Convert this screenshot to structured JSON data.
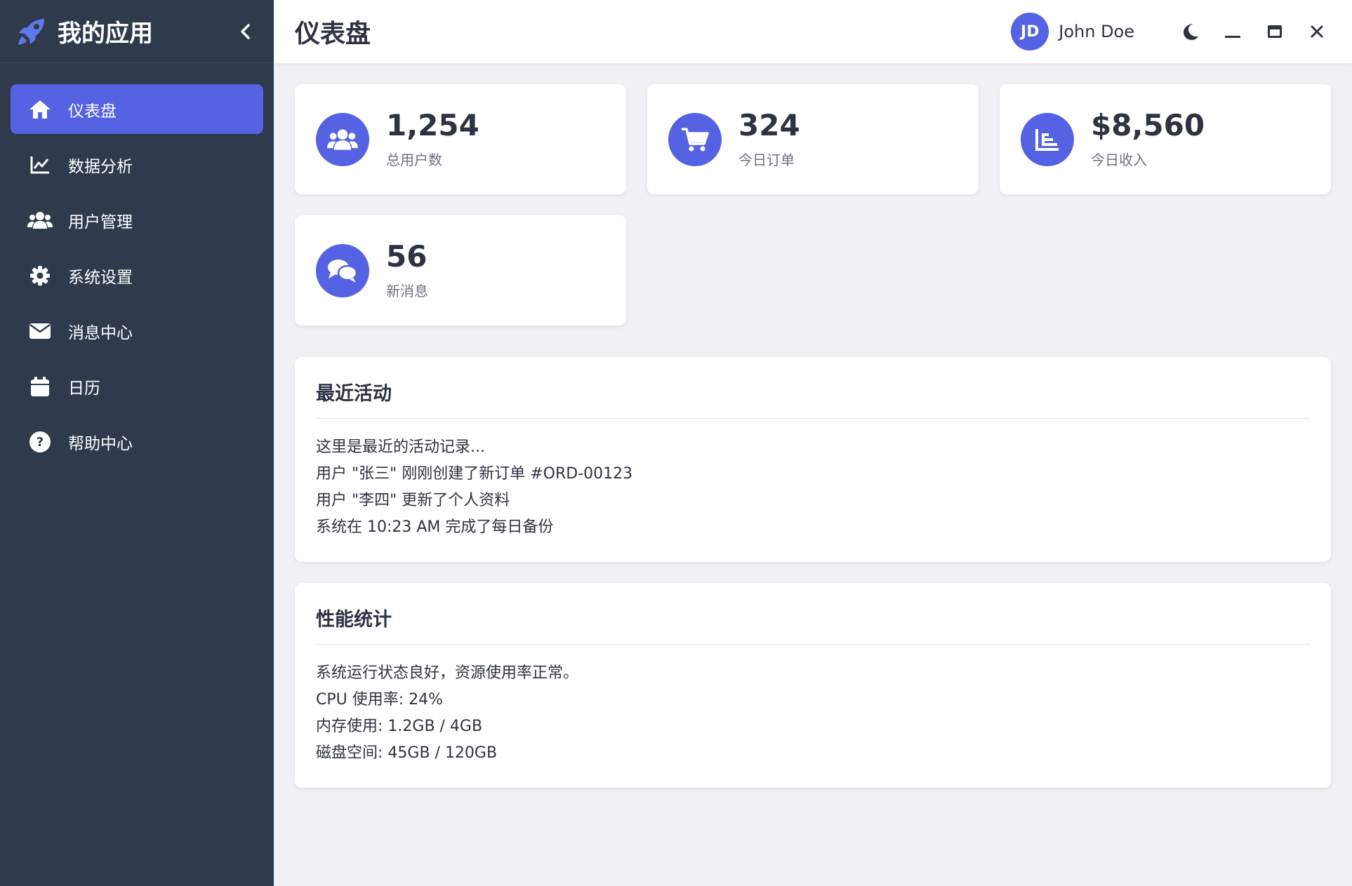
{
  "app": {
    "title": "我的应用",
    "brand_icon": "rocket-icon"
  },
  "sidebar": {
    "items": [
      {
        "label": "仪表盘",
        "icon": "home-icon",
        "active": true
      },
      {
        "label": "数据分析",
        "icon": "line-chart-icon",
        "active": false
      },
      {
        "label": "用户管理",
        "icon": "users-icon",
        "active": false
      },
      {
        "label": "系统设置",
        "icon": "gear-icon",
        "active": false
      },
      {
        "label": "消息中心",
        "icon": "envelope-icon",
        "active": false
      },
      {
        "label": "日历",
        "icon": "calendar-icon",
        "active": false
      },
      {
        "label": "帮助中心",
        "icon": "question-circle-icon",
        "active": false
      }
    ]
  },
  "header": {
    "title": "仪表盘",
    "user": {
      "initials": "JD",
      "name": "John Doe"
    }
  },
  "stats": [
    {
      "value": "1,254",
      "label": "总用户数",
      "icon": "users-icon"
    },
    {
      "value": "324",
      "label": "今日订单",
      "icon": "cart-icon"
    },
    {
      "value": "$8,560",
      "label": "今日收入",
      "icon": "bar-chart-icon"
    },
    {
      "value": "56",
      "label": "新消息",
      "icon": "comments-icon"
    }
  ],
  "panels": {
    "activity": {
      "title": "最近活动",
      "lines": [
        "这里是最近的活动记录...",
        "用户 \"张三\" 刚刚创建了新订单 #ORD-00123",
        "用户 \"李四\" 更新了个人资料",
        "系统在 10:23 AM 完成了每日备份"
      ]
    },
    "performance": {
      "title": "性能统计",
      "lines": [
        "系统运行状态良好，资源使用率正常。",
        "CPU 使用率: 24%",
        "内存使用: 1.2GB / 4GB",
        "磁盘空间: 45GB / 120GB"
      ]
    }
  },
  "colors": {
    "accent": "#5462e3",
    "sidebar_bg": "#2f3a4d",
    "page_bg": "#f0f1f4"
  }
}
